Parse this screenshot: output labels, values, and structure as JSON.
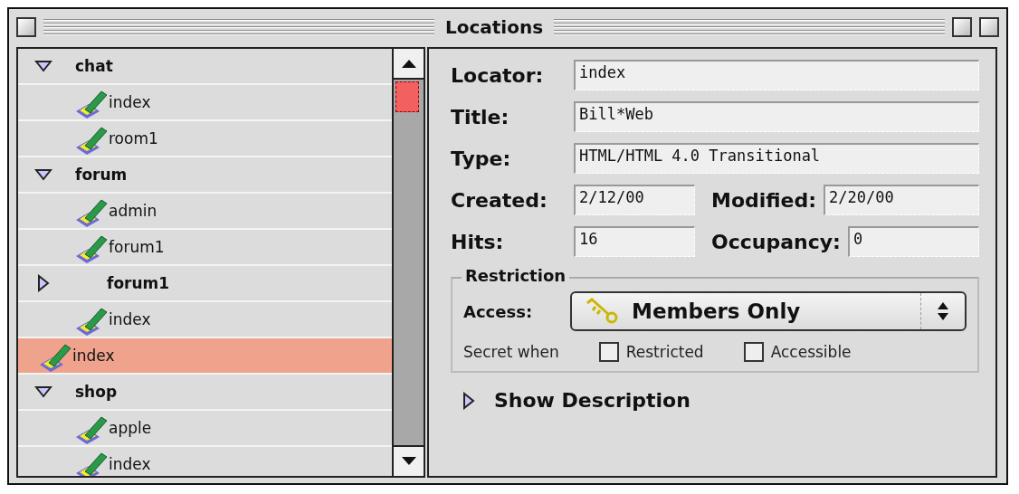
{
  "window": {
    "title": "Locations"
  },
  "tree": [
    {
      "label": "chat",
      "kind": "group",
      "expanded": true,
      "selected": false,
      "children": [
        {
          "label": "index",
          "kind": "page",
          "selected": false
        },
        {
          "label": "room1",
          "kind": "page",
          "selected": false
        }
      ]
    },
    {
      "label": "forum",
      "kind": "group",
      "expanded": true,
      "selected": false,
      "children": [
        {
          "label": "admin",
          "kind": "page",
          "selected": false
        },
        {
          "label": "forum1",
          "kind": "page",
          "selected": false
        },
        {
          "label": "forum1",
          "kind": "group",
          "expanded": false,
          "selected": false
        },
        {
          "label": "index",
          "kind": "page",
          "selected": false
        }
      ]
    },
    {
      "label": "index",
      "kind": "page",
      "selected": true
    },
    {
      "label": "shop",
      "kind": "group",
      "expanded": true,
      "selected": false,
      "children": [
        {
          "label": "apple",
          "kind": "page",
          "selected": false
        },
        {
          "label": "index",
          "kind": "page",
          "selected": false
        }
      ]
    }
  ],
  "details": {
    "rows": [
      [
        {
          "label": "Locator:",
          "value": "index"
        }
      ],
      [
        {
          "label": "Title:",
          "value": "Bill*Web"
        }
      ],
      [
        {
          "label": "Type:",
          "value": "HTML/HTML 4.0 Transitional"
        }
      ],
      [
        {
          "label": "Created:",
          "value": "2/12/00"
        },
        {
          "label": "Modified:",
          "value": "2/20/00"
        }
      ],
      [
        {
          "label": "Hits:",
          "value": "16"
        },
        {
          "label": "Occupancy:",
          "value": "0"
        }
      ]
    ],
    "restriction": {
      "title": "Restriction",
      "access_label": "Access:",
      "access_value": "Members Only",
      "secret_label": "Secret when",
      "checkboxes": [
        {
          "label": "Restricted",
          "checked": false
        },
        {
          "label": "Accessible",
          "checked": false
        }
      ]
    },
    "description": {
      "label": "Show Description",
      "expanded": false
    }
  }
}
